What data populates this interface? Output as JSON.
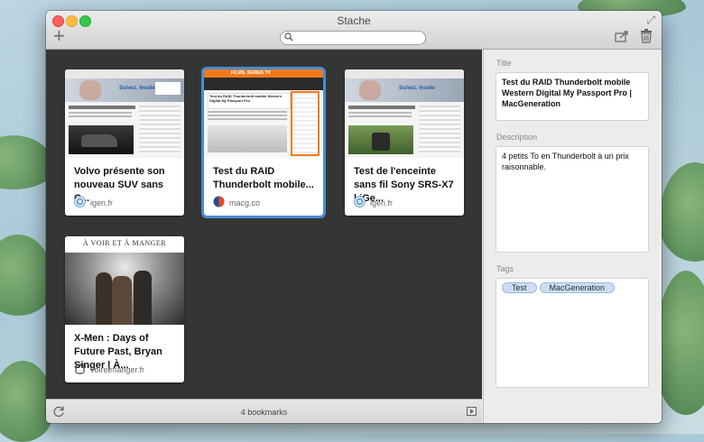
{
  "window": {
    "title": "Stache"
  },
  "toolbar": {
    "search_placeholder": "",
    "add_label": "+"
  },
  "cards": [
    {
      "title": "Volvo présente son nouveau SUV sans C...",
      "domain": "igen.fr"
    },
    {
      "title": "Test du RAID Thunderbolt mobile...",
      "domain": "macg.co"
    },
    {
      "title": "Test de l'enceinte sans fil Sony SRS-X7 | iGe...",
      "domain": "igen.fr"
    },
    {
      "title": "X-Men : Days of Future Past, Bryan Singer | À...",
      "domain": "voiretmanger.fr"
    }
  ],
  "thumbs": {
    "igen_brand": "Suivez. Inside",
    "macg_header": "FILMS. SERIES TV",
    "macg_headline": "Test du RAID Thunderbolt mobile Western Digital My Passport Pro",
    "voir_header": "À VOIR ET À MANGER"
  },
  "detail": {
    "title_label": "Title",
    "title_value": "Test du RAID Thunderbolt mobile Western Digital My Passport Pro | MacGeneration",
    "description_label": "Description",
    "description_value": "4 petits To en Thunderbolt à un prix raisonnable.",
    "tags_label": "Tags",
    "tags": [
      "Test",
      "MacGeneration"
    ]
  },
  "status": {
    "count": "4 bookmarks"
  },
  "colors": {
    "accent": "#4a8bd4",
    "grid_bg": "#353535",
    "macg_orange": "#f07a1a"
  }
}
